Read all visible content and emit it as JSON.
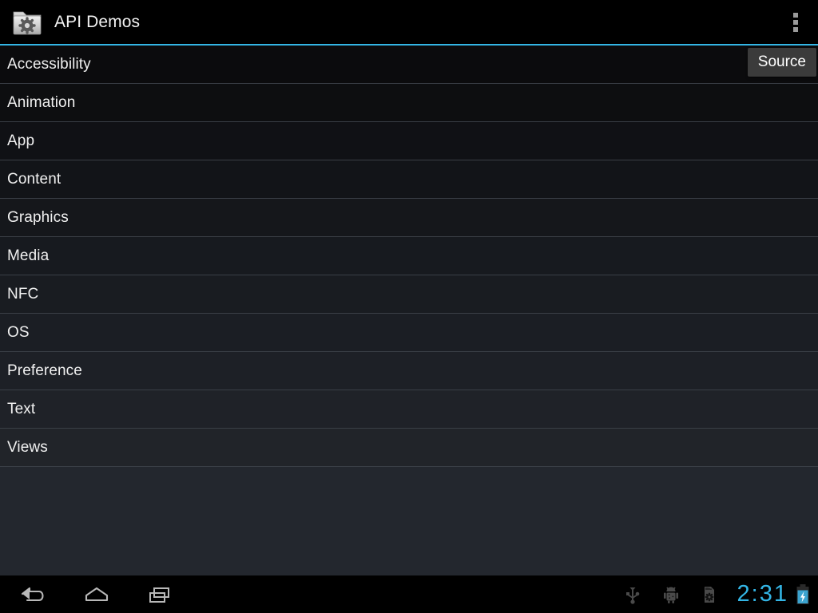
{
  "app": {
    "title": "API Demos",
    "icon": "folder-gear-icon"
  },
  "action_bar": {
    "overflow_label": "overflow-menu",
    "accent_color": "#33b5e5"
  },
  "tooltip": {
    "label": "Source"
  },
  "list": {
    "items": [
      {
        "label": "Accessibility"
      },
      {
        "label": "Animation"
      },
      {
        "label": "App"
      },
      {
        "label": "Content"
      },
      {
        "label": "Graphics"
      },
      {
        "label": "Media"
      },
      {
        "label": "NFC"
      },
      {
        "label": "OS"
      },
      {
        "label": "Preference"
      },
      {
        "label": "Text"
      },
      {
        "label": "Views"
      }
    ]
  },
  "nav_bar": {
    "back_label": "Back",
    "home_label": "Home",
    "recents_label": "Recent apps"
  },
  "status_bar": {
    "icons": [
      "usb-icon",
      "android-debug-icon",
      "sd-card-icon"
    ],
    "clock": "2:31",
    "battery": "battery-charging-icon",
    "clock_color": "#33b5e5"
  }
}
